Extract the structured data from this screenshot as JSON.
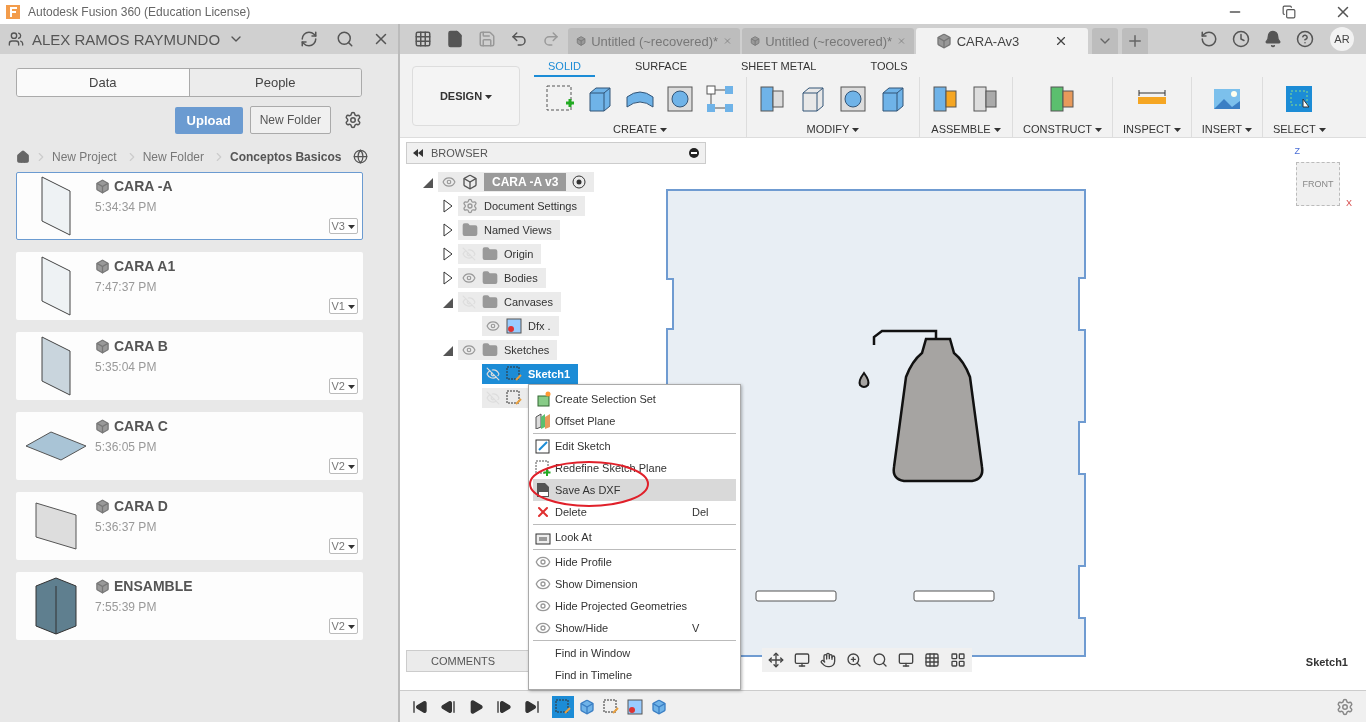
{
  "window": {
    "title": "Autodesk Fusion 360 (Education License)"
  },
  "data_panel": {
    "user": "ALEX RAMOS RAYMUNDO",
    "tabs": [
      {
        "label": "Data",
        "selected": true
      },
      {
        "label": "People",
        "selected": false
      }
    ],
    "upload": "Upload",
    "new_folder": "New Folder",
    "breadcrumb": [
      "New Project",
      "New Folder",
      "Conceptos Basicos"
    ],
    "files": [
      {
        "name": "CARA -A",
        "time": "5:34:34 PM",
        "version": "V3",
        "selected": true
      },
      {
        "name": "CARA A1",
        "time": "7:47:37 PM",
        "version": "V1",
        "selected": false
      },
      {
        "name": "CARA B",
        "time": "5:35:04 PM",
        "version": "V2",
        "selected": false
      },
      {
        "name": "CARA C",
        "time": "5:36:05 PM",
        "version": "V2",
        "selected": false
      },
      {
        "name": "CARA D",
        "time": "5:36:37 PM",
        "version": "V2",
        "selected": false
      },
      {
        "name": "ENSAMBLE",
        "time": "7:55:39 PM",
        "version": "V2",
        "selected": false
      }
    ]
  },
  "document_tabs": [
    {
      "title": "Untitled (~recovered)*",
      "selected": false
    },
    {
      "title": "Untitled (~recovered)*",
      "selected": false
    },
    {
      "title": "CARA-Av3",
      "selected": true
    }
  ],
  "user_initials": "AR",
  "toolbar": {
    "workspace": "DESIGN",
    "tabs": [
      {
        "label": "SOLID",
        "selected": true
      },
      {
        "label": "SURFACE",
        "selected": false
      },
      {
        "label": "SHEET METAL",
        "selected": false
      },
      {
        "label": "TOOLS",
        "selected": false
      }
    ],
    "groups": [
      "CREATE",
      "MODIFY",
      "ASSEMBLE",
      "CONSTRUCT",
      "INSPECT",
      "INSERT",
      "SELECT"
    ]
  },
  "browser": {
    "title": "BROWSER",
    "root": {
      "label": "CARA -A v3",
      "visible": true,
      "expanded": true,
      "children": [
        {
          "label": "Document Settings",
          "kind": "settings",
          "expanded": false
        },
        {
          "label": "Named Views",
          "kind": "folder",
          "expanded": false
        },
        {
          "label": "Origin",
          "kind": "folder",
          "visible": false,
          "expanded": false
        },
        {
          "label": "Bodies",
          "kind": "folder",
          "visible": true,
          "expanded": false
        },
        {
          "label": "Canvases",
          "kind": "folder",
          "visible": false,
          "expanded": true,
          "children": [
            {
              "label": "Dfx .",
              "kind": "canvas",
              "visible": true,
              "selected": false
            }
          ]
        },
        {
          "label": "Sketches",
          "kind": "folder",
          "visible": true,
          "expanded": true,
          "children": [
            {
              "label": "Sketch1",
              "kind": "sketch",
              "visible": false,
              "selected": true
            },
            {
              "kind": "sketch",
              "visible": false,
              "selected": false
            }
          ]
        }
      ]
    }
  },
  "context_menu": [
    [
      {
        "label": "Create Selection Set",
        "kind": "selset",
        "highlighted": false
      },
      {
        "label": "Offset Plane",
        "kind": "plane",
        "highlighted": false
      }
    ],
    [
      {
        "label": "Edit Sketch",
        "kind": "edit",
        "highlighted": false
      },
      {
        "label": "Redefine Sketch Plane",
        "kind": "redefine",
        "highlighted": false
      },
      {
        "label": "Save As DXF",
        "kind": "dxf",
        "highlighted": true
      },
      {
        "label": "Delete",
        "kind": "delete",
        "shortcut": "Del",
        "highlighted": false
      }
    ],
    [
      {
        "label": "Look At",
        "kind": "look",
        "highlighted": false
      }
    ],
    [
      {
        "label": "Hide Profile",
        "kind": "eye",
        "highlighted": false
      },
      {
        "label": "Show Dimension",
        "kind": "eye",
        "highlighted": false
      },
      {
        "label": "Hide Projected Geometries",
        "kind": "eye",
        "highlighted": false
      },
      {
        "label": "Show/Hide",
        "kind": "eye",
        "shortcut": "V",
        "highlighted": false
      }
    ],
    [
      {
        "label": "Find in Window",
        "kind": "none",
        "highlighted": false
      },
      {
        "label": "Find in Timeline",
        "kind": "none",
        "highlighted": false
      }
    ]
  ],
  "viewcube": {
    "face": "FRONT",
    "axis_z": "Z",
    "axis_x": "X"
  },
  "comments": "COMMENTS",
  "active_sketch": "Sketch1"
}
